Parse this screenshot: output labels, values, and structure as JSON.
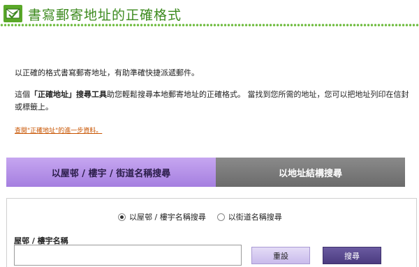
{
  "header": {
    "title": "書寫郵寄地址的正確格式",
    "logo_icon": "envelope-check-icon"
  },
  "intro": {
    "line1": "以正確的格式書寫郵寄地址，有助準確快捷派遞郵件。",
    "line2_pre": "這個",
    "line2_bold": "「正確地址」搜尋工具",
    "line2_post": "助您輕鬆搜尋本地郵寄地址的正確格式。 當找到您所需的地址，您可以把地址列印在信封或標籤上。",
    "more_link": "查閱\"正確地址\"的進一步資料。"
  },
  "tabs": [
    {
      "label": "以屋邨 / 樓宇 / 街道名稱搜尋",
      "active": true
    },
    {
      "label": "以地址結構搜尋",
      "active": false
    }
  ],
  "search_form": {
    "radio_options": [
      {
        "label": "以屋邨 / 樓宇名稱搜尋",
        "selected": true
      },
      {
        "label": "以街道名稱搜尋",
        "selected": false
      }
    ],
    "field_label": "屋邨 / 樓宇名稱",
    "field_value": "",
    "reset_label": "重設",
    "search_label": "搜尋"
  },
  "colors": {
    "title_green": "#3c8a1e",
    "active_tab": "#a57fe0",
    "inactive_tab": "#6b6b6b",
    "link_orange": "#c85400"
  }
}
